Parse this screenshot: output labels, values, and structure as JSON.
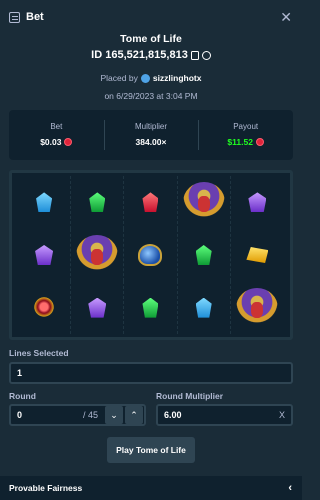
{
  "header": {
    "title": "Bet",
    "close_icon": "close-icon"
  },
  "info": {
    "game_name": "Tome of Life",
    "bet_id": "ID 165,521,815,813",
    "placed_prefix": "Placed by",
    "username": "sizzlinghotx",
    "date": "on 6/29/2023 at 3:04 PM"
  },
  "stats": {
    "bet_label": "Bet",
    "bet_value": "$0.03",
    "multiplier_label": "Multiplier",
    "multiplier_value": "384.00×",
    "payout_label": "Payout",
    "payout_value": "$11.52",
    "payout_color": "#1fff20",
    "currency_icon": "ruby-coin-icon"
  },
  "grid": {
    "rows": [
      [
        "blue-gem",
        "green-gem",
        "red-gem",
        "pharaoh",
        "purple-gem"
      ],
      [
        "purple-gem",
        "pharaoh",
        "scarab",
        "green-gem",
        "yellow-gem"
      ],
      [
        "red-lamp",
        "purple-gem",
        "green-gem",
        "blue-gem",
        "pharaoh"
      ]
    ]
  },
  "lines": {
    "label": "Lines Selected",
    "value": "1"
  },
  "round": {
    "label": "Round",
    "value": "0",
    "suffix": "/ 45"
  },
  "round_multiplier": {
    "label": "Round Multiplier",
    "value": "6.00",
    "suffix": "X"
  },
  "play_button": "Play Tome of Life",
  "footer": {
    "label": "Provable Fairness"
  }
}
